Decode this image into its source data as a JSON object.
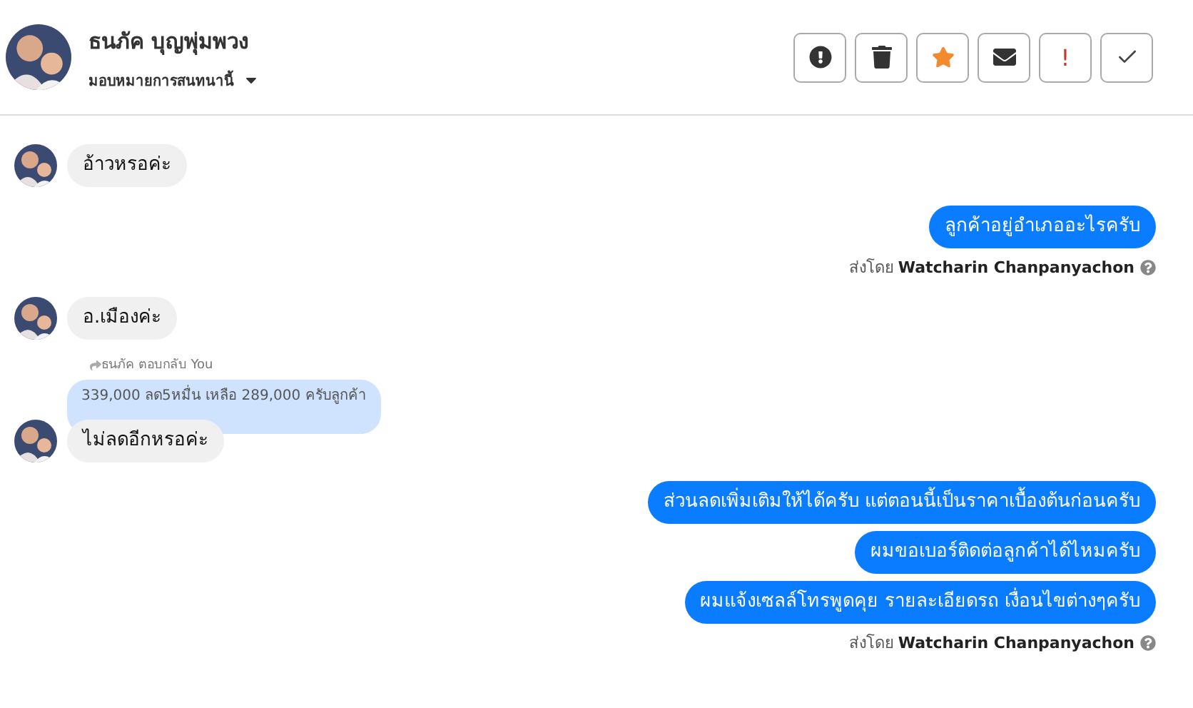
{
  "header": {
    "name": "ธนภัค บุญพุ่มพวง",
    "assign": "มอบหมายการสนทนานี้"
  },
  "actions": [
    {
      "kind": "alert"
    },
    {
      "kind": "trash"
    },
    {
      "kind": "star"
    },
    {
      "kind": "mail"
    },
    {
      "kind": "text",
      "label": "!"
    },
    {
      "kind": "check"
    }
  ],
  "messages": [
    {
      "kind": "incoming",
      "text": "อ้าวหรอค่ะ"
    },
    {
      "kind": "outgoing",
      "text": "ลูกค้าอยู่อำเภออะไรครับ"
    },
    {
      "kind": "sent_by",
      "prefix": "ส่งโดย",
      "name": "Watcharin Chanpanyachon"
    },
    {
      "kind": "incoming",
      "text": "อ.เมืองค่ะ"
    },
    {
      "kind": "reply",
      "label": "ธนภัค ตอบกลับ You",
      "quote": "339,000 ลด5หมื่น เหลือ 289,000 ครับลูกค้า",
      "text": "ไม่ลดอีกหรอค่ะ"
    },
    {
      "kind": "outgoing",
      "text": "ส่วนลดเพิ่มเติมให้ได้ครับ แต่ตอนนี้เป็นราคาเบื้องต้นก่อนครับ"
    },
    {
      "kind": "outgoing",
      "text": "ผมขอเบอร์ติดต่อลูกค้าได้ไหมครับ"
    },
    {
      "kind": "outgoing",
      "text": "ผมแจ้งเซลล์โทรพูดคุย รายละเอียดรถ เงื่อนไขต่างๆครับ"
    },
    {
      "kind": "sent_by",
      "prefix": "ส่งโดย",
      "name": "Watcharin Chanpanyachon"
    }
  ]
}
